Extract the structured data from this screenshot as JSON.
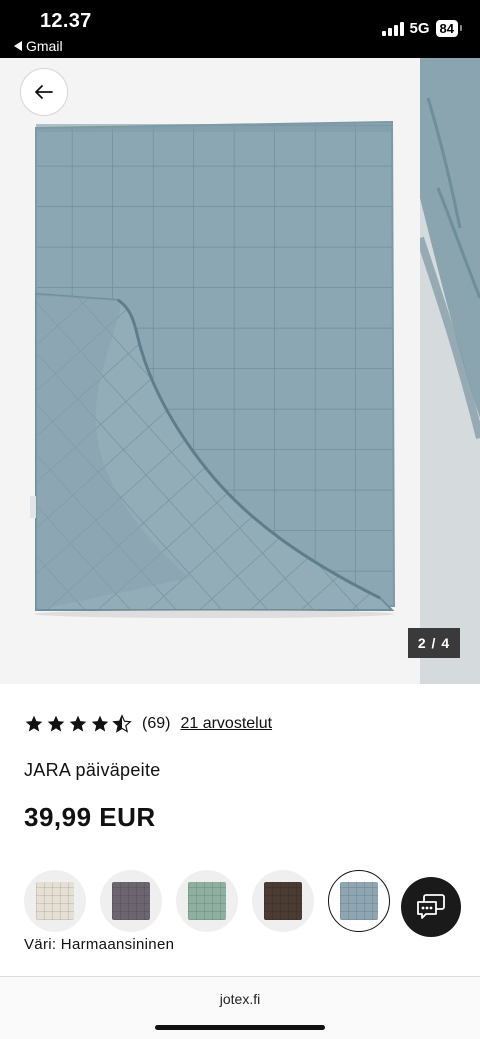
{
  "status_bar": {
    "time": "12.37",
    "back_app": "Gmail",
    "network": "5G",
    "battery": "84"
  },
  "gallery": {
    "pager": "2 / 4",
    "back_icon": "arrow-left-icon"
  },
  "product": {
    "rating_value": 4.5,
    "rating_count": "(69)",
    "reviews_link": "21 arvostelut",
    "title": "JARA päiväpeite",
    "price": "39,99 EUR",
    "color_label": "Väri: Harmaansininen",
    "swatches": [
      {
        "color": "#e6e0d4",
        "selected": false
      },
      {
        "color": "#6c6570",
        "selected": false
      },
      {
        "color": "#8fb0a0",
        "selected": false
      },
      {
        "color": "#4a3b33",
        "selected": false
      },
      {
        "color": "#8ea6b2",
        "selected": true
      }
    ]
  },
  "chat": {
    "icon": "chat-icon"
  },
  "browser": {
    "url": "jotex.fi"
  },
  "colors": {
    "quilt": "#8ba7b3",
    "quilt_dark": "#6f8e9b",
    "pager_bg": "#3a3a3a"
  }
}
